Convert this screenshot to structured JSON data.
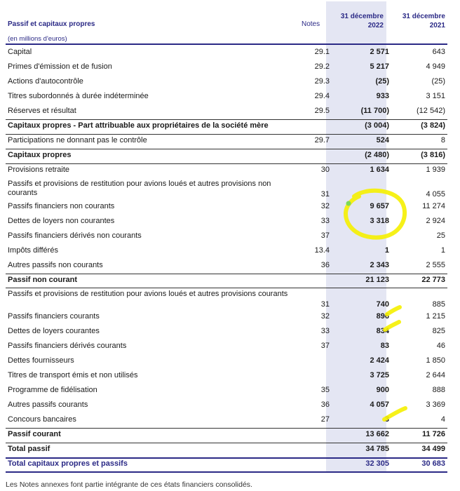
{
  "header": {
    "title": "Passif et capitaux propres",
    "unit": "(en millions d'euros)",
    "notes": "Notes",
    "col_2022": [
      "31 décembre",
      "2022"
    ],
    "col_2021": [
      "31 décembre",
      "2021"
    ]
  },
  "rows": [
    {
      "label": "Capital",
      "note": "29.1",
      "v2022": "2 571",
      "v2021": "643"
    },
    {
      "label": "Primes d'émission et de fusion",
      "note": "29.2",
      "v2022": "5 217",
      "v2021": "4 949"
    },
    {
      "label": "Actions d'autocontrôle",
      "note": "29.3",
      "v2022": "(25)",
      "v2021": "(25)"
    },
    {
      "label": "Titres subordonnés à durée indéterminée",
      "note": "29.4",
      "v2022": "933",
      "v2021": "3 151"
    },
    {
      "label": "Réserves et résultat",
      "note": "29.5",
      "v2022": "(11 700)",
      "v2021": "(12 542)"
    },
    {
      "label": "Capitaux propres - Part attribuable aux propriétaires de la société mère",
      "note": "",
      "v2022": "(3 004)",
      "v2021": "(3 824)"
    },
    {
      "label": "Participations ne donnant pas le contrôle",
      "note": "29.7",
      "v2022": "524",
      "v2021": "8"
    },
    {
      "label": "Capitaux propres",
      "note": "",
      "v2022": "(2 480)",
      "v2021": "(3 816)"
    },
    {
      "label": "Provisions retraite",
      "note": "30",
      "v2022": "1 634",
      "v2021": "1 939"
    },
    {
      "label": "Passifs et provisions de restitution pour avions loués et autres provisions non courants",
      "note": "31",
      "v2022": "",
      "v2021": "4 055"
    },
    {
      "label": "Passifs financiers non courants",
      "note": "32",
      "v2022": "9 657",
      "v2021": "11 274"
    },
    {
      "label": "Dettes de loyers non courantes",
      "note": "33",
      "v2022": "3 318",
      "v2021": "2 924"
    },
    {
      "label": "Passifs financiers dérivés non courants",
      "note": "37",
      "v2022": "",
      "v2021": "25"
    },
    {
      "label": "Impôts différés",
      "note": "13.4",
      "v2022": "1",
      "v2021": "1"
    },
    {
      "label": "Autres passifs non courants",
      "note": "36",
      "v2022": "2 343",
      "v2021": "2 555"
    },
    {
      "label": "Passif non courant",
      "note": "",
      "v2022": "21 123",
      "v2021": "22 773"
    },
    {
      "label": "Passifs et provisions de restitution pour avions loués et autres provisions courants",
      "note": "31",
      "v2022": "740",
      "v2021": "885"
    },
    {
      "label": "Passifs financiers courants",
      "note": "32",
      "v2022": "896",
      "v2021": "1 215"
    },
    {
      "label": "Dettes de loyers courantes",
      "note": "33",
      "v2022": "834",
      "v2021": "825"
    },
    {
      "label": "Passifs financiers dérivés courants",
      "note": "37",
      "v2022": "83",
      "v2021": "46"
    },
    {
      "label": "Dettes fournisseurs",
      "note": "",
      "v2022": "2 424",
      "v2021": "1 850"
    },
    {
      "label": "Titres de transport émis et non utilisés",
      "note": "",
      "v2022": "3 725",
      "v2021": "2 644"
    },
    {
      "label": "Programme de fidélisation",
      "note": "35",
      "v2022": "900",
      "v2021": "888"
    },
    {
      "label": "Autres passifs courants",
      "note": "36",
      "v2022": "4 057",
      "v2021": "3 369"
    },
    {
      "label": "Concours bancaires",
      "note": "27",
      "v2022": "3",
      "v2021": "4"
    },
    {
      "label": "Passif courant",
      "note": "",
      "v2022": "13 662",
      "v2021": "11 726"
    },
    {
      "label": "Total passif",
      "note": "",
      "v2022": "34 785",
      "v2021": "34 499"
    },
    {
      "label": "Total capitaux propres et passifs",
      "note": "",
      "v2022": "32 305",
      "v2021": "30 683"
    }
  ],
  "footer": "Les Notes annexes font partie intégrante de ces états financiers consolidés.",
  "colors": {
    "accent": "#2b2a86",
    "highlight_column": "#e4e6f3",
    "marker": "#f5f000"
  }
}
